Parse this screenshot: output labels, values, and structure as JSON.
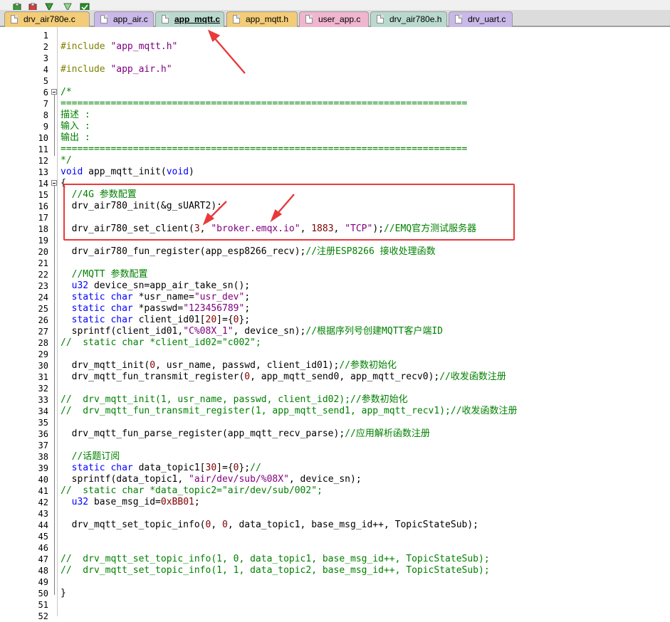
{
  "tabs": [
    {
      "label": "drv_air780e.c",
      "color": "#f2cc78"
    },
    {
      "label": "app_air.c",
      "color": "#c9b9e8"
    },
    {
      "label": "app_mqtt.c",
      "color": "#b9d9cf",
      "active": true
    },
    {
      "label": "app_mqtt.h",
      "color": "#f2cc78"
    },
    {
      "label": "user_app.c",
      "color": "#f0b6cf"
    },
    {
      "label": "drv_air780e.h",
      "color": "#b9d9cf"
    },
    {
      "label": "drv_uart.c",
      "color": "#c9b9e8"
    }
  ],
  "toolbar": {
    "icons": [
      "build-icon",
      "rebuild-icon",
      "download-icon",
      "debug-icon",
      "check-icon"
    ]
  },
  "colors": {
    "keyword": "#0000ff",
    "string": "#800080",
    "comment": "#008000",
    "preprocessor": "#808000",
    "number": "#800000",
    "annotation": "#e83a3a"
  },
  "lines": [
    {
      "n": "1",
      "segs": []
    },
    {
      "n": "2",
      "segs": [
        [
          "pp",
          "#include "
        ],
        [
          "str",
          "\"app_mqtt.h\""
        ]
      ]
    },
    {
      "n": "3",
      "segs": []
    },
    {
      "n": "4",
      "segs": [
        [
          "pp",
          "#include "
        ],
        [
          "str",
          "\"app_air.h\""
        ]
      ]
    },
    {
      "n": "5",
      "segs": []
    },
    {
      "n": "6",
      "segs": [
        [
          "cm",
          "/*"
        ]
      ]
    },
    {
      "n": "7",
      "segs": [
        [
          "cm",
          "========================================================================="
        ]
      ]
    },
    {
      "n": "8",
      "segs": [
        [
          "cm",
          "描述 :"
        ]
      ]
    },
    {
      "n": "9",
      "segs": [
        [
          "cm",
          "输入 :"
        ]
      ]
    },
    {
      "n": "10",
      "segs": [
        [
          "cm",
          "输出 :"
        ]
      ]
    },
    {
      "n": "11",
      "segs": [
        [
          "cm",
          "========================================================================="
        ]
      ]
    },
    {
      "n": "12",
      "segs": [
        [
          "cm",
          "*/"
        ]
      ]
    },
    {
      "n": "13",
      "segs": [
        [
          "kw",
          "void"
        ],
        [
          "plain",
          " app_mqtt_init("
        ],
        [
          "kw",
          "void"
        ],
        [
          "plain",
          ")"
        ]
      ]
    },
    {
      "n": "14",
      "segs": [
        [
          "plain",
          "{"
        ]
      ]
    },
    {
      "n": "15",
      "segs": [
        [
          "plain",
          "  "
        ],
        [
          "cm",
          "//4G 参数配置"
        ]
      ]
    },
    {
      "n": "16",
      "segs": [
        [
          "plain",
          "  drv_air780_init(&g_sUART2);"
        ]
      ]
    },
    {
      "n": "17",
      "segs": []
    },
    {
      "n": "18",
      "segs": [
        [
          "plain",
          "  drv_air780_set_client("
        ],
        [
          "num",
          "3"
        ],
        [
          "plain",
          ", "
        ],
        [
          "str",
          "\"broker.emqx.io\""
        ],
        [
          "plain",
          ", "
        ],
        [
          "num",
          "1883"
        ],
        [
          "plain",
          ", "
        ],
        [
          "str",
          "\"TCP\""
        ],
        [
          "plain",
          ");"
        ],
        [
          "cm",
          "//EMQ官方测试服务器"
        ]
      ]
    },
    {
      "n": "19",
      "segs": []
    },
    {
      "n": "20",
      "segs": [
        [
          "plain",
          "  drv_air780_fun_register(app_esp8266_recv);"
        ],
        [
          "cm",
          "//注册ESP8266 接收处理函数"
        ]
      ]
    },
    {
      "n": "21",
      "segs": []
    },
    {
      "n": "22",
      "segs": [
        [
          "plain",
          "  "
        ],
        [
          "cm",
          "//MQTT 参数配置"
        ]
      ]
    },
    {
      "n": "23",
      "segs": [
        [
          "plain",
          "  "
        ],
        [
          "kw",
          "u32"
        ],
        [
          "plain",
          " device_sn=app_air_take_sn();"
        ]
      ]
    },
    {
      "n": "24",
      "segs": [
        [
          "plain",
          "  "
        ],
        [
          "kw",
          "static"
        ],
        [
          "plain",
          " "
        ],
        [
          "kw",
          "char"
        ],
        [
          "plain",
          " *usr_name="
        ],
        [
          "str",
          "\"usr_dev\""
        ],
        [
          "plain",
          ";"
        ]
      ]
    },
    {
      "n": "25",
      "segs": [
        [
          "plain",
          "  "
        ],
        [
          "kw",
          "static"
        ],
        [
          "plain",
          " "
        ],
        [
          "kw",
          "char"
        ],
        [
          "plain",
          " *passwd="
        ],
        [
          "str",
          "\"123456789\""
        ],
        [
          "plain",
          ";"
        ]
      ]
    },
    {
      "n": "26",
      "segs": [
        [
          "plain",
          "  "
        ],
        [
          "kw",
          "static"
        ],
        [
          "plain",
          " "
        ],
        [
          "kw",
          "char"
        ],
        [
          "plain",
          " client_id01["
        ],
        [
          "num",
          "20"
        ],
        [
          "plain",
          "]={"
        ],
        [
          "num",
          "0"
        ],
        [
          "plain",
          "};"
        ]
      ]
    },
    {
      "n": "27",
      "segs": [
        [
          "plain",
          "  sprintf(client_id01,"
        ],
        [
          "str",
          "\"C%08X_1\""
        ],
        [
          "plain",
          ", device_sn);"
        ],
        [
          "cm",
          "//根据序列号创建MQTT客户端ID"
        ]
      ]
    },
    {
      "n": "28",
      "segs": [
        [
          "cm",
          "//  static char *client_id02=\"c002\";"
        ]
      ]
    },
    {
      "n": "29",
      "segs": []
    },
    {
      "n": "30",
      "segs": [
        [
          "plain",
          "  drv_mqtt_init("
        ],
        [
          "num",
          "0"
        ],
        [
          "plain",
          ", usr_name, passwd, client_id01);"
        ],
        [
          "cm",
          "//参数初始化"
        ]
      ]
    },
    {
      "n": "31",
      "segs": [
        [
          "plain",
          "  drv_mqtt_fun_transmit_register("
        ],
        [
          "num",
          "0"
        ],
        [
          "plain",
          ", app_mqtt_send0, app_mqtt_recv0);"
        ],
        [
          "cm",
          "//收发函数注册"
        ]
      ]
    },
    {
      "n": "32",
      "segs": []
    },
    {
      "n": "33",
      "segs": [
        [
          "cm",
          "//  drv_mqtt_init(1, usr_name, passwd, client_id02);//参数初始化"
        ]
      ]
    },
    {
      "n": "34",
      "segs": [
        [
          "cm",
          "//  drv_mqtt_fun_transmit_register(1, app_mqtt_send1, app_mqtt_recv1);//收发函数注册"
        ]
      ]
    },
    {
      "n": "35",
      "segs": []
    },
    {
      "n": "36",
      "segs": [
        [
          "plain",
          "  drv_mqtt_fun_parse_register(app_mqtt_recv_parse);"
        ],
        [
          "cm",
          "//应用解析函数注册"
        ]
      ]
    },
    {
      "n": "37",
      "segs": []
    },
    {
      "n": "38",
      "segs": [
        [
          "plain",
          "  "
        ],
        [
          "cm",
          "//话题订阅"
        ]
      ]
    },
    {
      "n": "39",
      "segs": [
        [
          "plain",
          "  "
        ],
        [
          "kw",
          "static"
        ],
        [
          "plain",
          " "
        ],
        [
          "kw",
          "char"
        ],
        [
          "plain",
          " data_topic1["
        ],
        [
          "num",
          "30"
        ],
        [
          "plain",
          "]={"
        ],
        [
          "num",
          "0"
        ],
        [
          "plain",
          "};"
        ],
        [
          "cm",
          "//"
        ]
      ]
    },
    {
      "n": "40",
      "segs": [
        [
          "plain",
          "  sprintf(data_topic1, "
        ],
        [
          "str",
          "\"air/dev/sub/%08X\""
        ],
        [
          "plain",
          ", device_sn);"
        ]
      ]
    },
    {
      "n": "41",
      "segs": [
        [
          "cm",
          "//  static char *data_topic2=\"air/dev/sub/002\";"
        ]
      ]
    },
    {
      "n": "42",
      "segs": [
        [
          "plain",
          "  "
        ],
        [
          "kw",
          "u32"
        ],
        [
          "plain",
          " base_msg_id="
        ],
        [
          "num",
          "0xBB01"
        ],
        [
          "plain",
          ";"
        ]
      ]
    },
    {
      "n": "43",
      "segs": []
    },
    {
      "n": "44",
      "segs": [
        [
          "plain",
          "  drv_mqtt_set_topic_info("
        ],
        [
          "num",
          "0"
        ],
        [
          "plain",
          ", "
        ],
        [
          "num",
          "0"
        ],
        [
          "plain",
          ", data_topic1, base_msg_id++, TopicStateSub);"
        ]
      ]
    },
    {
      "n": "45",
      "segs": []
    },
    {
      "n": "46",
      "segs": []
    },
    {
      "n": "47",
      "segs": [
        [
          "cm",
          "//  drv_mqtt_set_topic_info(1, 0, data_topic1, base_msg_id++, TopicStateSub);"
        ]
      ]
    },
    {
      "n": "48",
      "segs": [
        [
          "cm",
          "//  drv_mqtt_set_topic_info(1, 1, data_topic2, base_msg_id++, TopicStateSub);"
        ]
      ]
    },
    {
      "n": "49",
      "segs": []
    },
    {
      "n": "50",
      "segs": [
        [
          "plain",
          "}"
        ]
      ]
    },
    {
      "n": "51",
      "segs": []
    },
    {
      "n": "52",
      "segs": []
    }
  ]
}
